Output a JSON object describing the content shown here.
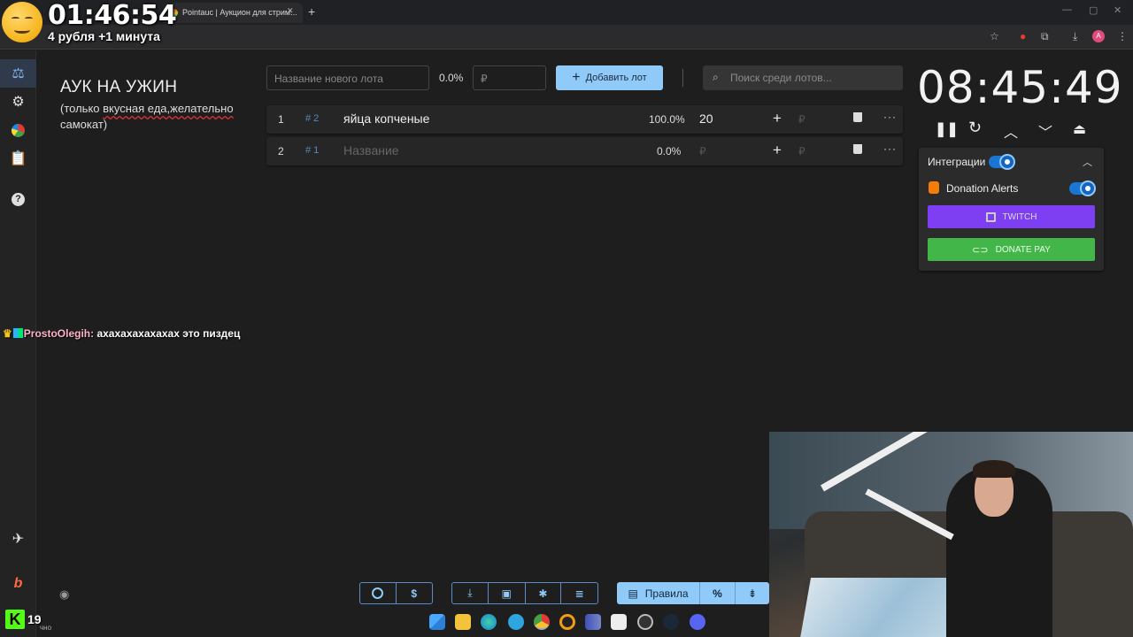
{
  "browser": {
    "tab_title": "Pointauc | Аукцион для стрим...",
    "tab_close": "✕",
    "new_tab": "+"
  },
  "overlay": {
    "time": "01:46:54",
    "subtitle": "4 рубля +1 минута"
  },
  "auction": {
    "title": "АУК НА УЖИН",
    "description_plain": "(только ",
    "description_underlined": "вкусная еда,желательно",
    "description_end": " самокат)"
  },
  "new_lot": {
    "name_placeholder": "Название нового лота",
    "percent": "0.0%",
    "amount_placeholder": "₽",
    "add_label": "Добавить лот",
    "search_placeholder": "Поиск среди лотов..."
  },
  "lots": [
    {
      "index": "1",
      "id": "# 2",
      "name": "яйца копченые",
      "name_is_placeholder": false,
      "percent": "100.0%",
      "amount": "20",
      "amount_placeholder": "",
      "ruble": "₽",
      "more": "···"
    },
    {
      "index": "2",
      "id": "# 1",
      "name": "Название",
      "name_is_placeholder": true,
      "percent": "0.0%",
      "amount": "",
      "amount_placeholder": "₽",
      "ruble": "₽",
      "more": "···"
    }
  ],
  "timer": {
    "time": "08:45:49",
    "controls": [
      "pause",
      "reset",
      "increase",
      "decrease",
      "speed-up"
    ]
  },
  "integrations": {
    "label": "Интеграции",
    "enabled": true,
    "donation_alerts_label": "Donation Alerts",
    "donation_alerts_enabled": true,
    "twitch_label": "TWITCH",
    "donatepay_label": "DONATE PAY",
    "colors": {
      "twitch": "#7e3ff2",
      "donatepay": "#43b649",
      "toggle": "#1976d2"
    }
  },
  "chat": {
    "user": "ProstoOlegih:",
    "message": "ахахахахахахах это пиздец"
  },
  "toolbar": {
    "rules_label": "Правила",
    "percent_symbol": "%"
  },
  "kick": {
    "logo": "K",
    "count": "19",
    "sub": "чно"
  }
}
